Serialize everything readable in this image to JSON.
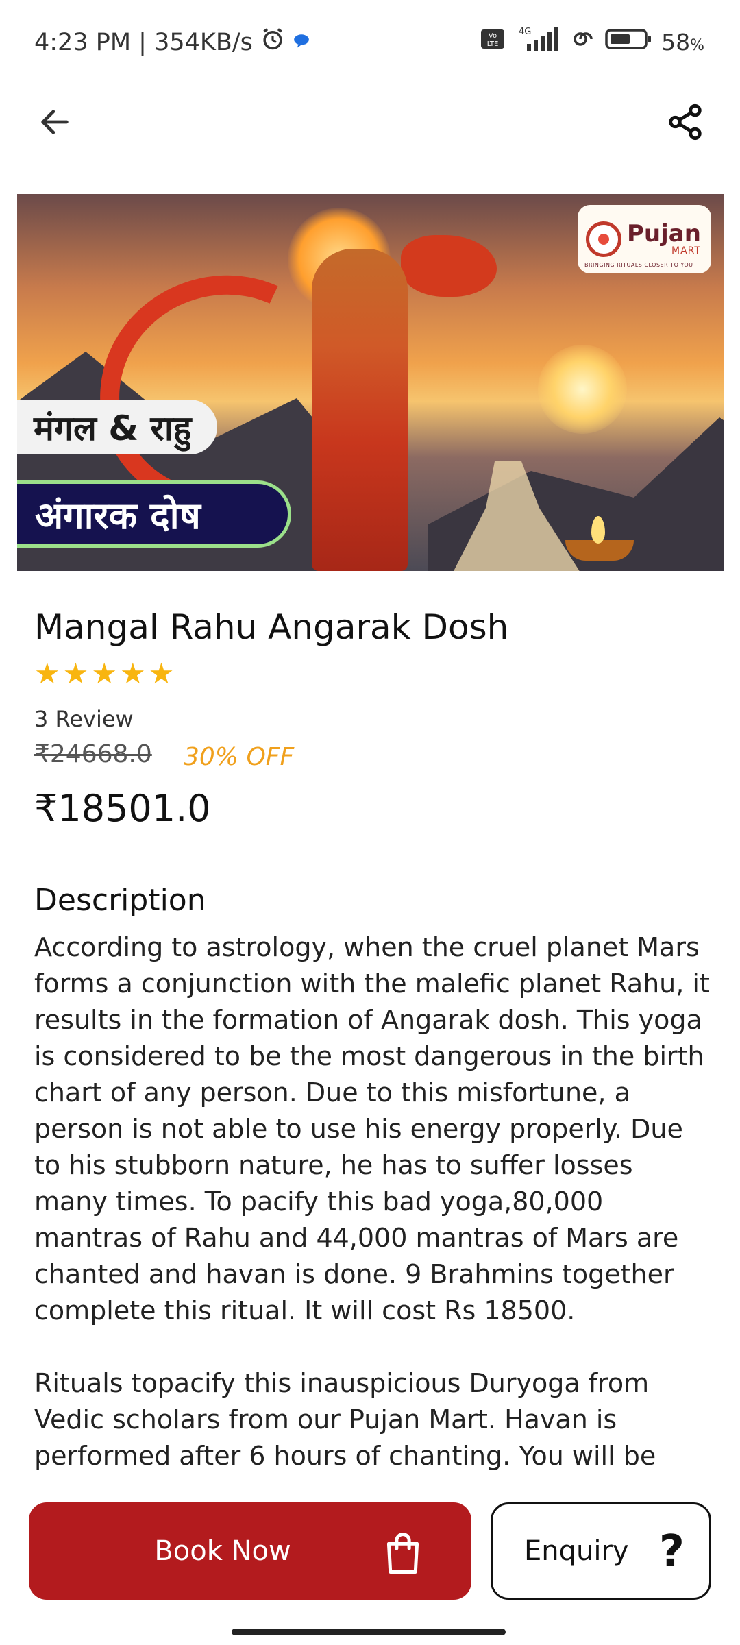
{
  "status_bar": {
    "time_speed": "4:23 PM | 354KB/s",
    "network": "4G",
    "battery": "58",
    "battery_unit": "%"
  },
  "hero": {
    "logo_main": "Pujan",
    "logo_sub": "MART",
    "logo_tagline": "BRINGING RITUALS CLOSER TO YOU",
    "hindi_line_1": "मंगल & राहु",
    "hindi_line_2": "अंगारक दोष"
  },
  "product": {
    "title": "Mangal Rahu Angarak Dosh",
    "rating": 5,
    "stars": [
      "★",
      "★",
      "★",
      "★",
      "★"
    ],
    "reviews": "3 Review",
    "old_price": "₹24668.0",
    "discount": "30% OFF",
    "price": "₹18501.0"
  },
  "description": {
    "heading": "Description",
    "paragraph_1": "According to astrology, when the cruel planet Mars forms a conjunction with the malefic planet Rahu, it results in the formation of Angarak dosh. This yoga is considered to be the most dangerous in the birth chart of any person. Due to this misfortune, a person is not able to use his energy properly. Due to his stubborn nature, he has to suffer losses many times. To pacify this bad yoga,80,000 mantras of Rahu and 44,000 mantras of Mars are chanted and havan is done. 9 Brahmins together complete this ritual. It will cost Rs 18500.",
    "paragraph_2": "Rituals topacify this inauspicious Duryoga from Vedic scholars from our Pujan Mart. Havan is performed after 6 hours of chanting. You will be able to watch"
  },
  "actions": {
    "book_label": "Book Now",
    "enquiry_label": "Enquiry",
    "enquiry_icon": "?"
  },
  "colors": {
    "book_button": "#b31b1e",
    "star": "#f8b510",
    "discount": "#f0a01c"
  }
}
